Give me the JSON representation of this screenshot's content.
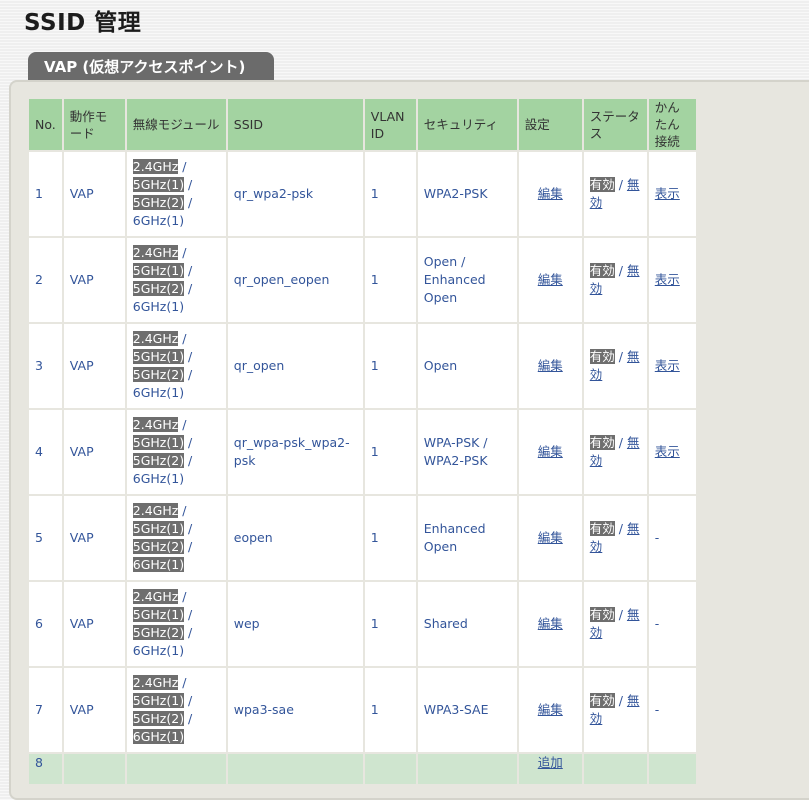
{
  "title": "SSID 管理",
  "tab_label": "VAP (仮想アクセスポイント)",
  "columns": [
    "No.",
    "動作モード",
    "無線モジュール",
    "SSID",
    "VLAN ID",
    "セキュリティ",
    "設定",
    "ステータス",
    "かんたん接続"
  ],
  "rows": [
    {
      "no": "1",
      "mode": "VAP",
      "mod": [
        "2.4GHz",
        "5GHz(1)",
        "5GHz(2)",
        "6GHz(1)"
      ],
      "mod_hl": [
        true,
        true,
        true,
        false
      ],
      "ssid": "qr_wpa2-psk",
      "vlan": "1",
      "sec": [
        "WPA2-PSK"
      ],
      "setting": "編集",
      "on": "有効",
      "off": "無効",
      "easy": "表示",
      "easy_link": true
    },
    {
      "no": "2",
      "mode": "VAP",
      "mod": [
        "2.4GHz",
        "5GHz(1)",
        "5GHz(2)",
        "6GHz(1)"
      ],
      "mod_hl": [
        true,
        true,
        true,
        false
      ],
      "ssid": "qr_open_eopen",
      "vlan": "1",
      "sec": [
        "Open /",
        "Enhanced Open"
      ],
      "setting": "編集",
      "on": "有効",
      "off": "無効",
      "easy": "表示",
      "easy_link": true
    },
    {
      "no": "3",
      "mode": "VAP",
      "mod": [
        "2.4GHz",
        "5GHz(1)",
        "5GHz(2)",
        "6GHz(1)"
      ],
      "mod_hl": [
        true,
        true,
        true,
        false
      ],
      "ssid": "qr_open",
      "vlan": "1",
      "sec": [
        "Open"
      ],
      "setting": "編集",
      "on": "有効",
      "off": "無効",
      "easy": "表示",
      "easy_link": true
    },
    {
      "no": "4",
      "mode": "VAP",
      "mod": [
        "2.4GHz",
        "5GHz(1)",
        "5GHz(2)",
        "6GHz(1)"
      ],
      "mod_hl": [
        true,
        true,
        true,
        false
      ],
      "ssid": "qr_wpa-psk_wpa2-psk",
      "vlan": "1",
      "sec": [
        "WPA-PSK /",
        "WPA2-PSK"
      ],
      "setting": "編集",
      "on": "有効",
      "off": "無効",
      "easy": "表示",
      "easy_link": true
    },
    {
      "no": "5",
      "mode": "VAP",
      "mod": [
        "2.4GHz",
        "5GHz(1)",
        "5GHz(2)",
        "6GHz(1)"
      ],
      "mod_hl": [
        true,
        true,
        true,
        true
      ],
      "ssid": "eopen",
      "vlan": "1",
      "sec": [
        "Enhanced Open"
      ],
      "setting": "編集",
      "on": "有効",
      "off": "無効",
      "easy": "-",
      "easy_link": false
    },
    {
      "no": "6",
      "mode": "VAP",
      "mod": [
        "2.4GHz",
        "5GHz(1)",
        "5GHz(2)",
        "6GHz(1)"
      ],
      "mod_hl": [
        true,
        true,
        true,
        false
      ],
      "ssid": "wep",
      "vlan": "1",
      "sec": [
        "Shared"
      ],
      "setting": "編集",
      "on": "有効",
      "off": "無効",
      "easy": "-",
      "easy_link": false
    },
    {
      "no": "7",
      "mode": "VAP",
      "mod": [
        "2.4GHz",
        "5GHz(1)",
        "5GHz(2)",
        "6GHz(1)"
      ],
      "mod_hl": [
        true,
        true,
        true,
        true
      ],
      "ssid": "wpa3-sae",
      "vlan": "1",
      "sec": [
        "WPA3-SAE"
      ],
      "setting": "編集",
      "on": "有効",
      "off": "無効",
      "easy": "-",
      "easy_link": false
    }
  ],
  "last_row": {
    "no": "8",
    "setting": "追加"
  },
  "status_separator": " / "
}
